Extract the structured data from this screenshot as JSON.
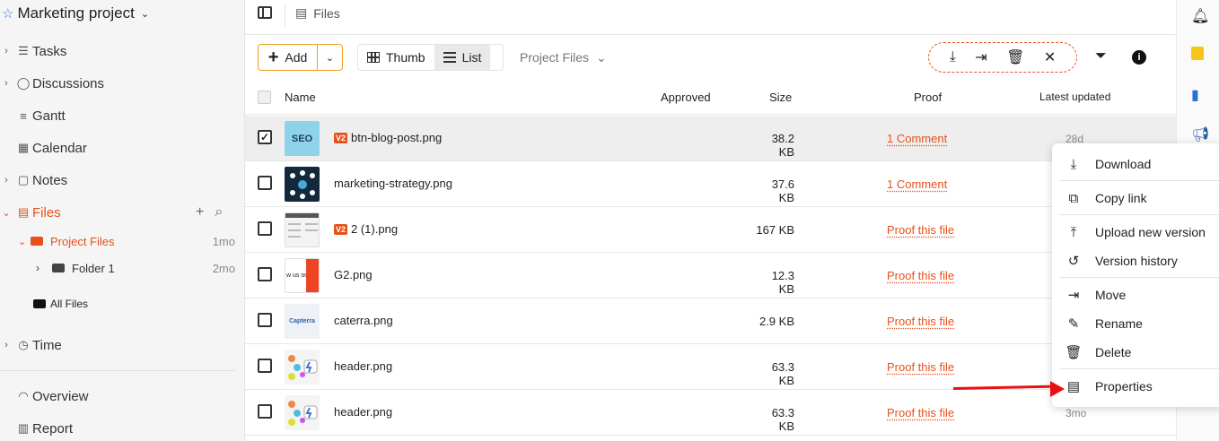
{
  "project": {
    "title": "Marketing project"
  },
  "sidebar": {
    "items": [
      {
        "label": "Tasks"
      },
      {
        "label": "Discussions"
      },
      {
        "label": "Gantt"
      },
      {
        "label": "Calendar"
      },
      {
        "label": "Notes"
      },
      {
        "label": "Files"
      },
      {
        "label": "Time"
      },
      {
        "label": "Overview"
      },
      {
        "label": "Report"
      }
    ],
    "tree": {
      "project_files": {
        "label": "Project Files",
        "date": "1mo"
      },
      "folder1": {
        "label": "Folder 1",
        "date": "2mo"
      },
      "all_files": {
        "label": "All Files"
      }
    }
  },
  "breadcrumb": {
    "label": "Files"
  },
  "toolbar": {
    "add_label": "Add",
    "thumb_label": "Thumb",
    "list_label": "List",
    "filter_label": "Project Files"
  },
  "table": {
    "headers": {
      "name": "Name",
      "approved": "Approved",
      "size": "Size",
      "proof": "Proof",
      "updated": "Latest updated"
    },
    "rows": [
      {
        "name": "btn-blog-post.png",
        "version": "V2",
        "size": "38.2 KB",
        "proof": "1 Comment",
        "updated": "28d",
        "checked": true,
        "thumb_text": "SEO"
      },
      {
        "name": "marketing-strategy.png",
        "version": "",
        "size": "37.6 KB",
        "proof": "1 Comment",
        "updated": "",
        "checked": false,
        "thumb_text": ""
      },
      {
        "name": "2 (1).png",
        "version": "V2",
        "size": "167 KB",
        "proof": "Proof this file",
        "updated": "",
        "checked": false,
        "thumb_text": ""
      },
      {
        "name": "G2.png",
        "version": "",
        "size": "12.3 KB",
        "proof": "Proof this file",
        "updated": "",
        "checked": false,
        "thumb_text": "w us on"
      },
      {
        "name": "caterra.png",
        "version": "",
        "size": "2.9 KB",
        "proof": "Proof this file",
        "updated": "",
        "checked": false,
        "thumb_text": "Capterra"
      },
      {
        "name": "header.png",
        "version": "",
        "size": "63.3 KB",
        "proof": "Proof this file",
        "updated": "",
        "checked": false,
        "thumb_text": ""
      },
      {
        "name": "header.png",
        "version": "",
        "size": "63.3 KB",
        "proof": "Proof this file",
        "updated": "3mo",
        "checked": false,
        "thumb_text": ""
      }
    ]
  },
  "context_menu": {
    "items": [
      {
        "label": "Download",
        "icon": "download-icon"
      },
      {
        "label": "Copy link",
        "icon": "copy-icon"
      },
      {
        "label": "Upload new version",
        "icon": "upload-icon"
      },
      {
        "label": "Version history",
        "icon": "history-icon"
      },
      {
        "label": "Move",
        "icon": "move-icon"
      },
      {
        "label": "Rename",
        "icon": "pencil-icon"
      },
      {
        "label": "Delete",
        "icon": "trash-icon"
      },
      {
        "label": "Properties",
        "icon": "document-icon"
      }
    ]
  },
  "colors": {
    "accent": "#e8501a",
    "annotation_arrow": "#e81010"
  }
}
